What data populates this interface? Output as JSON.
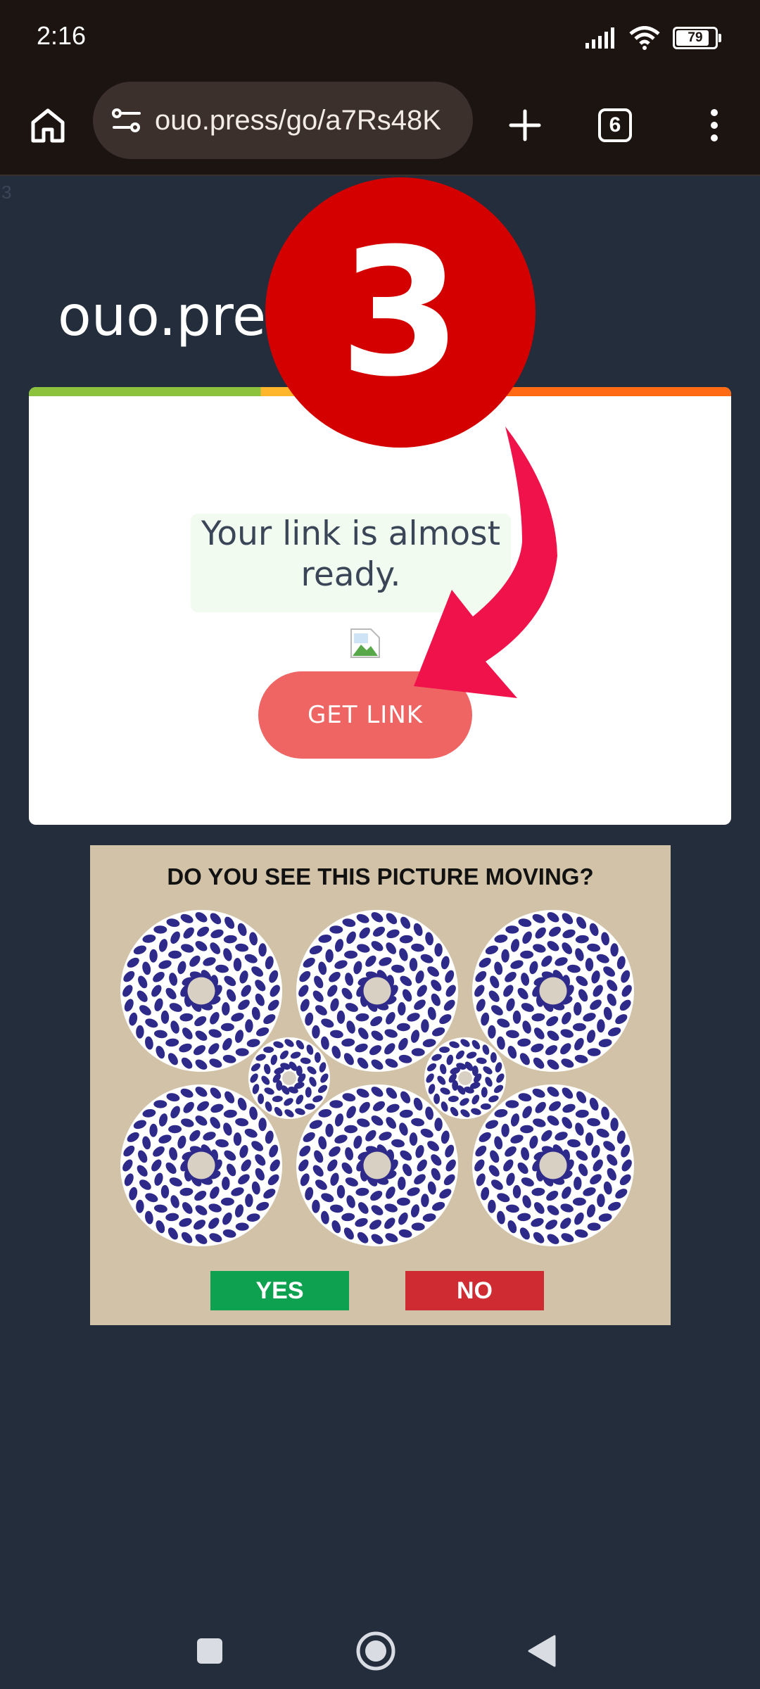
{
  "status_bar": {
    "time": "2:16",
    "battery": "79"
  },
  "browser": {
    "url": "ouo.press/go/a7Rs48K",
    "tab_count": "6"
  },
  "page": {
    "stray_text": "3",
    "site_title": "ouo.press",
    "message": "Your link is almost ready.",
    "button_label": "GET LINK"
  },
  "ad": {
    "question": "DO YOU SEE THIS PICTURE MOVING?",
    "yes_label": "YES",
    "no_label": "NO"
  },
  "annotation": {
    "step_number": "3"
  },
  "colors": {
    "page_bg": "#232d3b",
    "button": "#ef6563",
    "badge": "#d40000",
    "arrow": "#f0124a",
    "swirl_dark": "#2e2a8a"
  },
  "icons": [
    "home-icon",
    "site-settings-icon",
    "plus-icon",
    "tab-switcher-icon",
    "more-vertical-icon",
    "signal-icon",
    "wifi-icon",
    "battery-icon",
    "broken-image-icon",
    "recents-icon",
    "home-circle-icon",
    "back-triangle-icon"
  ]
}
